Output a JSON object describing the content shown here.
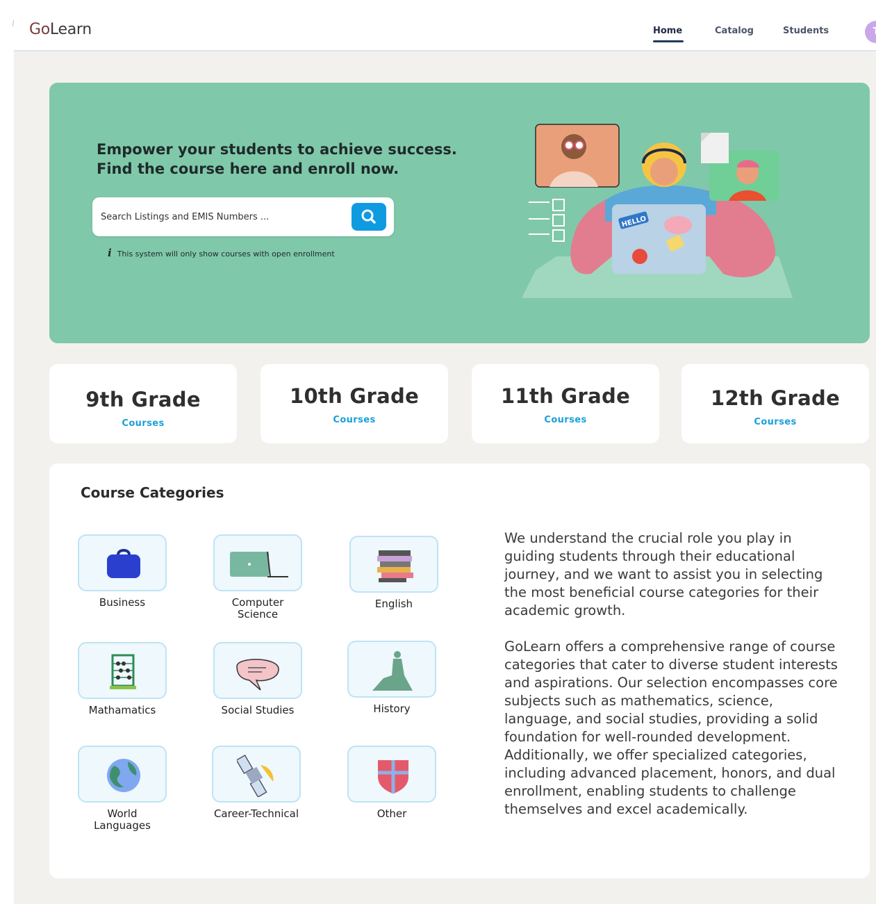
{
  "app": {
    "logo_go": "Go",
    "logo_learn": "Learn"
  },
  "nav": {
    "items": [
      "Home",
      "Catalog",
      "Students"
    ],
    "active": "Home",
    "avatar_initial": "T"
  },
  "hero": {
    "title_line1": "Empower your students to achieve success.",
    "title_line2": "Find the course here and enroll now.",
    "search_placeholder": "Search Listings and EMIS Numbers ...",
    "search_icon": "search-icon",
    "info_text": "This system will only show courses with open enrollment",
    "info_icon": "info-icon",
    "laptop_sticker": "HELLO",
    "bg_color": "#80c8aa"
  },
  "grades": [
    {
      "title": "9th Grade",
      "sub": "Courses"
    },
    {
      "title": "10th Grade",
      "sub": "Courses"
    },
    {
      "title": "11th Grade",
      "sub": "Courses"
    },
    {
      "title": "12th Grade",
      "sub": "Courses"
    }
  ],
  "categories": {
    "heading": "Course Categories",
    "items": [
      {
        "label": "Business",
        "icon": "briefcase-icon"
      },
      {
        "label": "Computer Science",
        "icon": "laptop-icon"
      },
      {
        "label": "English",
        "icon": "books-icon"
      },
      {
        "label": "Mathamatics",
        "icon": "abacus-icon"
      },
      {
        "label": "Social Studies",
        "icon": "speech-bubble-icon"
      },
      {
        "label": "History",
        "icon": "statue-icon"
      },
      {
        "label": "World Languages",
        "icon": "globe-icon"
      },
      {
        "label": "Career-Technical",
        "icon": "satellite-icon"
      },
      {
        "label": "Other",
        "icon": "shield-icon"
      }
    ],
    "description_p1": "We understand the crucial role you play in guiding students through their educational journey, and we want to assist you in selecting the most beneficial course categories for their academic growth.",
    "description_p2": "GoLearn offers a comprehensive range of course categories that cater to diverse student interests and aspirations. Our selection encompasses core subjects such as mathematics, science, language, and social studies, providing a solid foundation for well-rounded development. Additionally, we offer specialized categories, including advanced placement, honors, and dual enrollment, enabling students to challenge themselves and excel academically."
  },
  "colors": {
    "accent_blue": "#0f9be0",
    "link_blue": "#1aa0d8",
    "page_bg": "#f3f1ed",
    "tile_bg": "#eef8fd"
  }
}
